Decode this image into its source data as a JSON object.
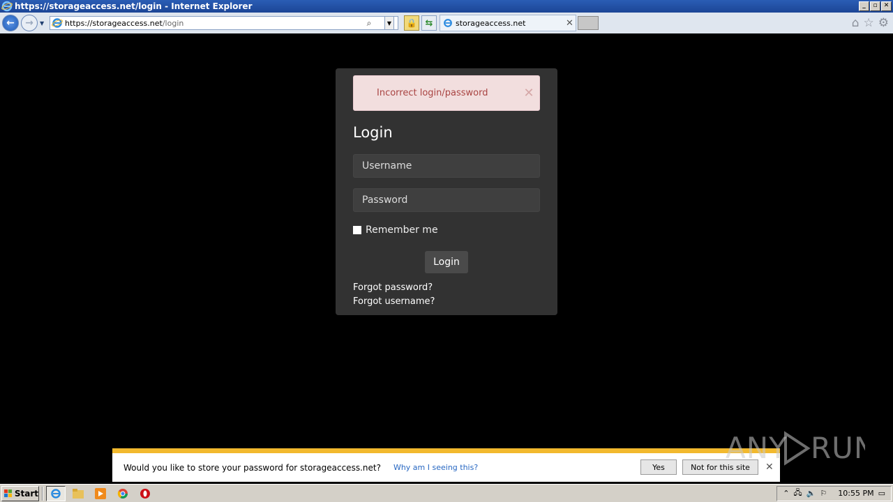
{
  "window": {
    "title": "https://storageaccess.net/login - Internet Explorer",
    "min_label": "_",
    "max_label": "▫",
    "close_label": "✕"
  },
  "nav": {
    "back_label": "←",
    "forward_label": "→",
    "address_host": "https://storageaccess.net",
    "address_path": "/login",
    "tab_title": "storageaccess.net",
    "tab_close": "✕"
  },
  "login": {
    "alert_text": "Incorrect login/password",
    "alert_close": "✕",
    "heading": "Login",
    "username_placeholder": "Username",
    "password_placeholder": "Password",
    "remember_label": "Remember me",
    "submit_label": "Login",
    "forgot_password": "Forgot password?",
    "forgot_username": "Forgot username?"
  },
  "password_bar": {
    "message": "Would you like to store your password for storageaccess.net?",
    "why_link": "Why am I seeing this?",
    "yes_label": "Yes",
    "not_site_label": "Not for this site",
    "close_label": "✕"
  },
  "watermark": "ANY RUN",
  "taskbar": {
    "start_label": "Start",
    "clock": "10:55 PM"
  },
  "colors": {
    "title_bar": "#1c4596",
    "card_bg": "#323232",
    "alert_bg": "#f2dede",
    "alert_text": "#a94442",
    "pwbar_accent": "#f2b92e",
    "link_blue": "#2767c2"
  }
}
